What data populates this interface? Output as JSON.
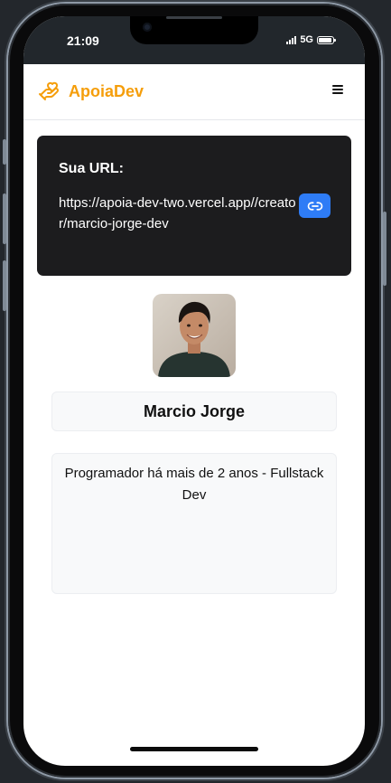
{
  "status": {
    "time": "21:09",
    "network": "5G"
  },
  "nav": {
    "brand": "ApoiaDev",
    "brand_color": "#f59e0b",
    "menu_icon": "hamburger-icon"
  },
  "url_card": {
    "title": "Sua URL:",
    "url": "https://apoia-dev-two.vercel.app//creator/marcio-jorge-dev",
    "copy_icon": "link-icon",
    "button_color": "#2e7cf6"
  },
  "profile": {
    "name": "Marcio Jorge",
    "bio": "Programador há mais de 2 anos - Fullstack Dev"
  }
}
